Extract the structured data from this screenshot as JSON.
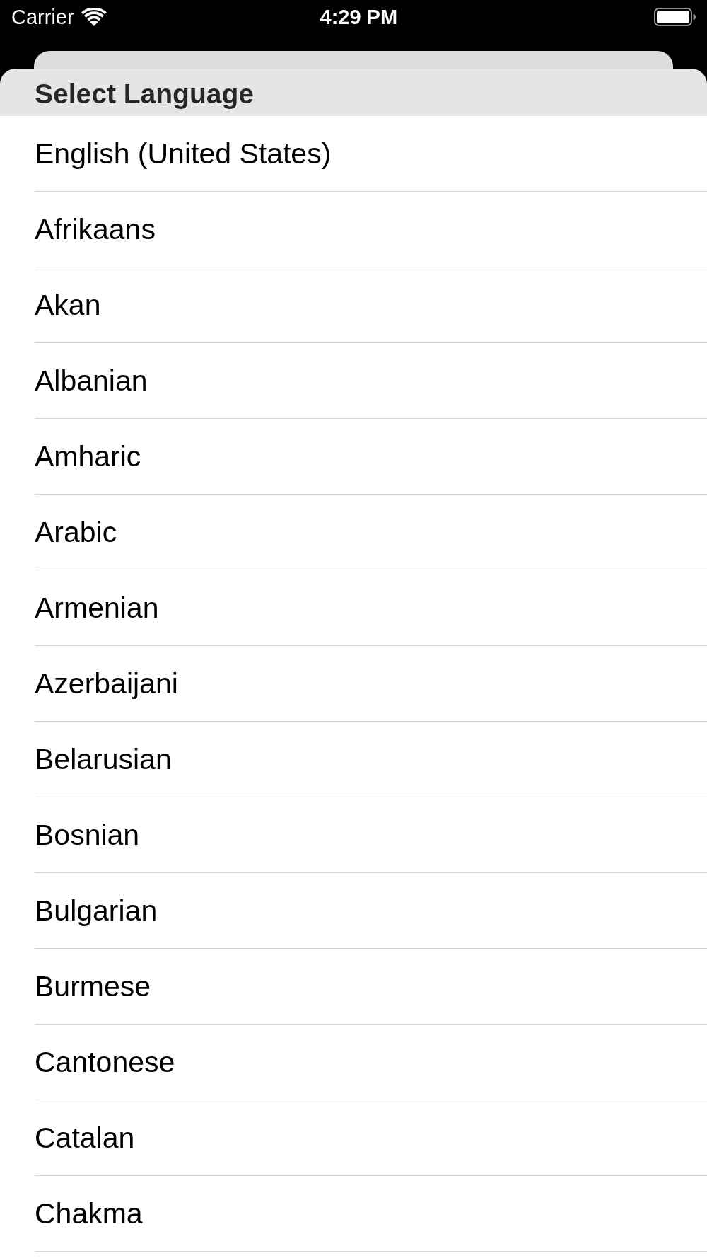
{
  "status_bar": {
    "carrier": "Carrier",
    "time": "4:29 PM"
  },
  "sheet": {
    "title": "Select Language",
    "languages": [
      "English (United States)",
      "Afrikaans",
      "Akan",
      "Albanian",
      "Amharic",
      "Arabic",
      "Armenian",
      "Azerbaijani",
      "Belarusian",
      "Bosnian",
      "Bulgarian",
      "Burmese",
      "Cantonese",
      "Catalan",
      "Chakma"
    ]
  }
}
